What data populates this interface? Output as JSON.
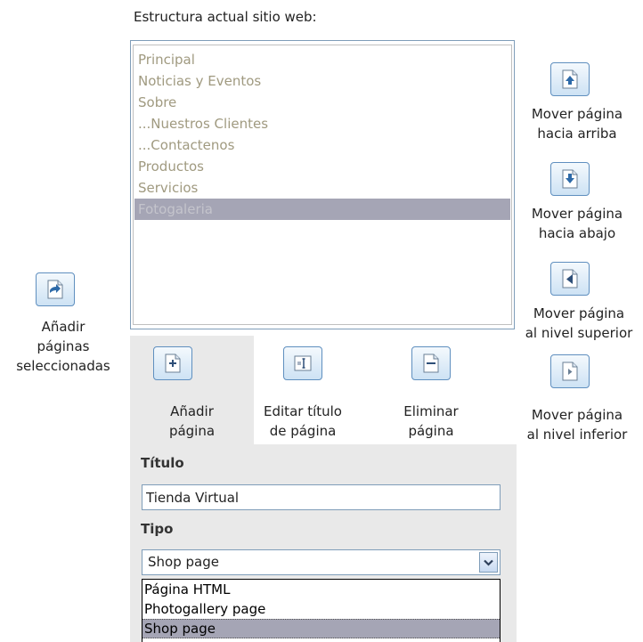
{
  "heading": "Estructura actual sitio web:",
  "tree": {
    "items": [
      {
        "label": "Principal"
      },
      {
        "label": "Noticias y Eventos"
      },
      {
        "label": "Sobre"
      },
      {
        "label": "...Nuestros Clientes"
      },
      {
        "label": "...Contactenos"
      },
      {
        "label": "Productos"
      },
      {
        "label": "Servicios"
      },
      {
        "label": "Fotogaleria"
      }
    ],
    "selected_item": "Fotogaleria"
  },
  "move_buttons": {
    "up": {
      "line1": "Mover página",
      "line2": "hacia arriba"
    },
    "down": {
      "line1": "Mover página",
      "line2": "hacia abajo"
    },
    "out": {
      "line1": "Mover página",
      "line2": "al nivel superior"
    },
    "in": {
      "line1": "Mover página",
      "line2": "al nivel inferior"
    }
  },
  "add_selected": {
    "line1": "Añadir",
    "line2": "páginas",
    "line3": "seleccionadas"
  },
  "actions": {
    "add_page": {
      "line1": "Añadir",
      "line2": "página"
    },
    "edit_title": {
      "line1": "Editar título",
      "line2": "de página"
    },
    "delete_page": {
      "line1": "Eliminar",
      "line2": "página"
    }
  },
  "form": {
    "title_label": "Título",
    "title_value": "Tienda Virtual",
    "type_label": "Tipo",
    "type_value": "Shop page",
    "type_options": [
      "Página HTML",
      "Photogallery page",
      "Shop page"
    ]
  },
  "colors": {
    "button_border": "#5f8fbf",
    "icon_blue": "#2e6aa8",
    "panel_bg": "#e9e9e9",
    "selection_bg": "#a5a5b5",
    "tree_text": "#a09a80"
  },
  "icons": {
    "move_up": "page-arrow-up-icon",
    "move_down": "page-arrow-down-icon",
    "move_out": "page-arrow-left-icon",
    "move_in": "page-arrow-right-icon",
    "add_selected": "page-add-arrow-icon",
    "add_page": "page-plus-icon",
    "edit_title": "page-edit-icon",
    "delete_page": "page-minus-icon",
    "dropdown": "chevron-down-icon"
  }
}
